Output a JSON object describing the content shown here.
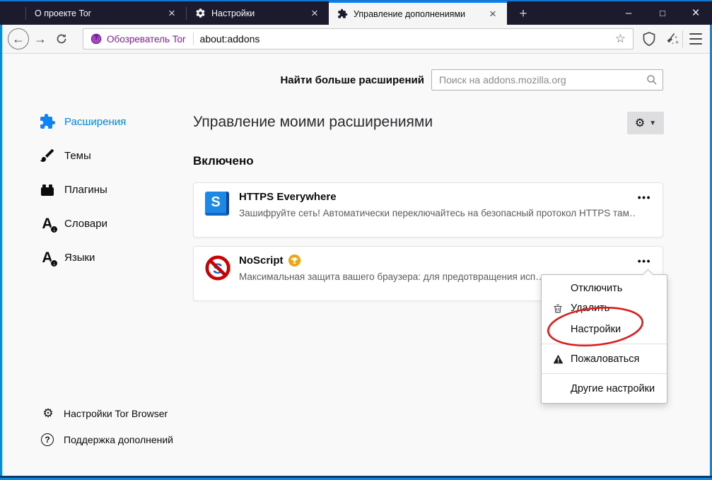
{
  "titlebar": {
    "tabs": [
      {
        "label": "О проекте Tor"
      },
      {
        "label": "Настройки"
      },
      {
        "label": "Управление дополнениями"
      }
    ],
    "close_glyph": "×",
    "new_tab_glyph": "+",
    "minimize_glyph": "–",
    "maximize_glyph": "□"
  },
  "toolbar": {
    "back_glyph": "←",
    "forward_glyph": "→",
    "identity_label": "Обозреватель Tor",
    "url": "about:addons"
  },
  "search": {
    "label": "Найти больше расширений",
    "placeholder": "Поиск на addons.mozilla.org"
  },
  "sidebar": {
    "items": [
      {
        "label": "Расширения"
      },
      {
        "label": "Темы"
      },
      {
        "label": "Плагины"
      },
      {
        "label": "Словари"
      },
      {
        "label": "Языки"
      }
    ],
    "footer": [
      {
        "label": "Настройки Tor Browser"
      },
      {
        "label": "Поддержка дополнений"
      }
    ]
  },
  "main": {
    "title": "Управление моими расширениями",
    "section_enabled": "Включено",
    "menu_glyph": "•••",
    "extensions": [
      {
        "name": "HTTPS Everywhere",
        "description": "Зашифруйте сеть! Автоматически переключайтесь на безопасный протокол HTTPS там…"
      },
      {
        "name": "NoScript",
        "description": "Максимальная защита вашего браузера: для предотвращения исп…"
      }
    ]
  },
  "context_menu": {
    "items": [
      {
        "label": "Отключить"
      },
      {
        "label": "Удалить"
      },
      {
        "label": "Настройки"
      },
      {
        "label": "Пожаловаться"
      },
      {
        "label": "Другие настройки"
      }
    ],
    "highlighted": "Настройки"
  },
  "colors": {
    "accent_blue": "#0a84ff",
    "tor_purple": "#881fa3",
    "titlebar_bg": "#1c1b2e",
    "highlight_red": "#dd1d1d",
    "window_border": "#0f87d9"
  }
}
